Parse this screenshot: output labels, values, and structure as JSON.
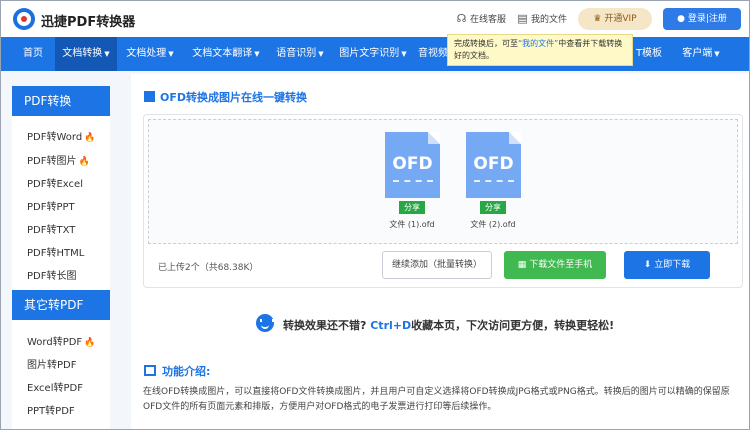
{
  "header": {
    "brand": "迅捷PDF转换器",
    "online_service": "在线客服",
    "my_files": "我的文件",
    "vip": "开通VIP",
    "login": "登录|注册"
  },
  "nav": {
    "items": [
      {
        "label": "首页",
        "caret": false
      },
      {
        "label": "文档转换",
        "caret": true
      },
      {
        "label": "文档处理",
        "caret": true
      },
      {
        "label": "文档文本翻译",
        "caret": true
      },
      {
        "label": "语音识别",
        "caret": true
      },
      {
        "label": "图片文字识别",
        "caret": true
      },
      {
        "label": "音视频",
        "caret": false
      },
      {
        "label": "T模板",
        "caret": false
      },
      {
        "label": "客户端",
        "caret": true
      }
    ]
  },
  "tooltip": {
    "part1": "完成转换后，可至",
    "link": "“我的文件”",
    "part2": "中查看并下载转换好的文档。"
  },
  "sidebar": {
    "group1_title": "PDF转换",
    "group1_items": [
      {
        "label": "PDF转Word",
        "hot": true
      },
      {
        "label": "PDF转图片",
        "hot": true
      },
      {
        "label": "PDF转Excel",
        "hot": false
      },
      {
        "label": "PDF转PPT",
        "hot": false
      },
      {
        "label": "PDF转TXT",
        "hot": false
      },
      {
        "label": "PDF转HTML",
        "hot": false
      },
      {
        "label": "PDF转长图",
        "hot": false
      }
    ],
    "group2_title": "其它转PDF",
    "group2_items": [
      {
        "label": "Word转PDF",
        "hot": true
      },
      {
        "label": "图片转PDF",
        "hot": false
      },
      {
        "label": "Excel转PDF",
        "hot": false
      },
      {
        "label": "PPT转PDF",
        "hot": false
      }
    ]
  },
  "main": {
    "title": "OFD转换成图片在线一键转换",
    "files": [
      {
        "badge": "OFD",
        "share": "分享",
        "name": "文件 (1).ofd"
      },
      {
        "badge": "OFD",
        "share": "分享",
        "name": "文件 (2).ofd"
      }
    ],
    "uploaded_count": "已上传2个（共68.38K）",
    "continue_button": "继续添加（批量转换）",
    "phone_button": "下载文件至手机",
    "download_button": "立即下载",
    "tip_prefix": "转换效果还不错?",
    "tip_key": "Ctrl+D",
    "tip_suffix": "收藏本页，下次访问更方便，转换更轻松!",
    "intro_title": "功能介绍:",
    "intro_text": "在线OFD转换成图片，可以直接将OFD文件转换成图片，并且用户可自定义选择将OFD转换成JPG格式或PNG格式。转换后的图片可以精确的保留原OFD文件的所有页面元素和排版，方便用户对OFD格式的电子发票进行打印等后续操作。"
  },
  "colors": {
    "primary": "#1d74e5",
    "nav_active": "#1458b6",
    "success": "#3fb950",
    "hot": "#f06a2a",
    "vip_bg": "#f6e6c8"
  }
}
